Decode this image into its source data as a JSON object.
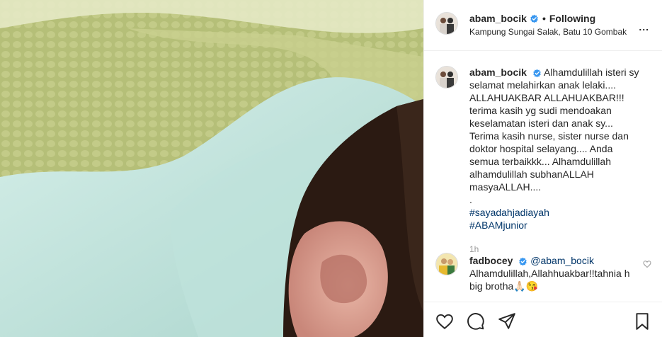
{
  "header": {
    "username": "abam_bocik",
    "separator": "•",
    "follow_status": "Following",
    "location": "Kampung Sungai Salak, Batu 10 Gombak",
    "more_label": "..."
  },
  "caption": {
    "username": "abam_bocik",
    "text": "Alhamdulillah isteri sy selamat melahirkan anak lelaki.... ALLAHUAKBAR ALLAHUAKBAR!!! terima kasih yg sudi mendoakan keselamatan isteri dan anak sy... Terima kasih nurse, sister nurse dan doktor hospital selayang.... Anda semua terbaikkk... Alhamdulillah alhamdulillah subhanALLAH masyaALLAH....",
    "dot_line": ".",
    "hashtags": [
      "#sayadahjadiayah",
      "#ABAMjunior"
    ],
    "age": "1h"
  },
  "comments": [
    {
      "username": "fadbocey",
      "mention": "@abam_bocik",
      "text": "Alhamdulillah,Allahhuakbar!!tahnia h big brotha🙏🏻😘"
    }
  ],
  "icons": {
    "verified": "verified-badge-icon",
    "like": "heart-icon",
    "comment": "speech-bubble-icon",
    "share": "paper-plane-icon",
    "save": "bookmark-icon",
    "more": "more-options-icon"
  },
  "colors": {
    "verified": "#3897f0",
    "hashtag": "#003569",
    "muted": "#999999",
    "text": "#262626"
  }
}
